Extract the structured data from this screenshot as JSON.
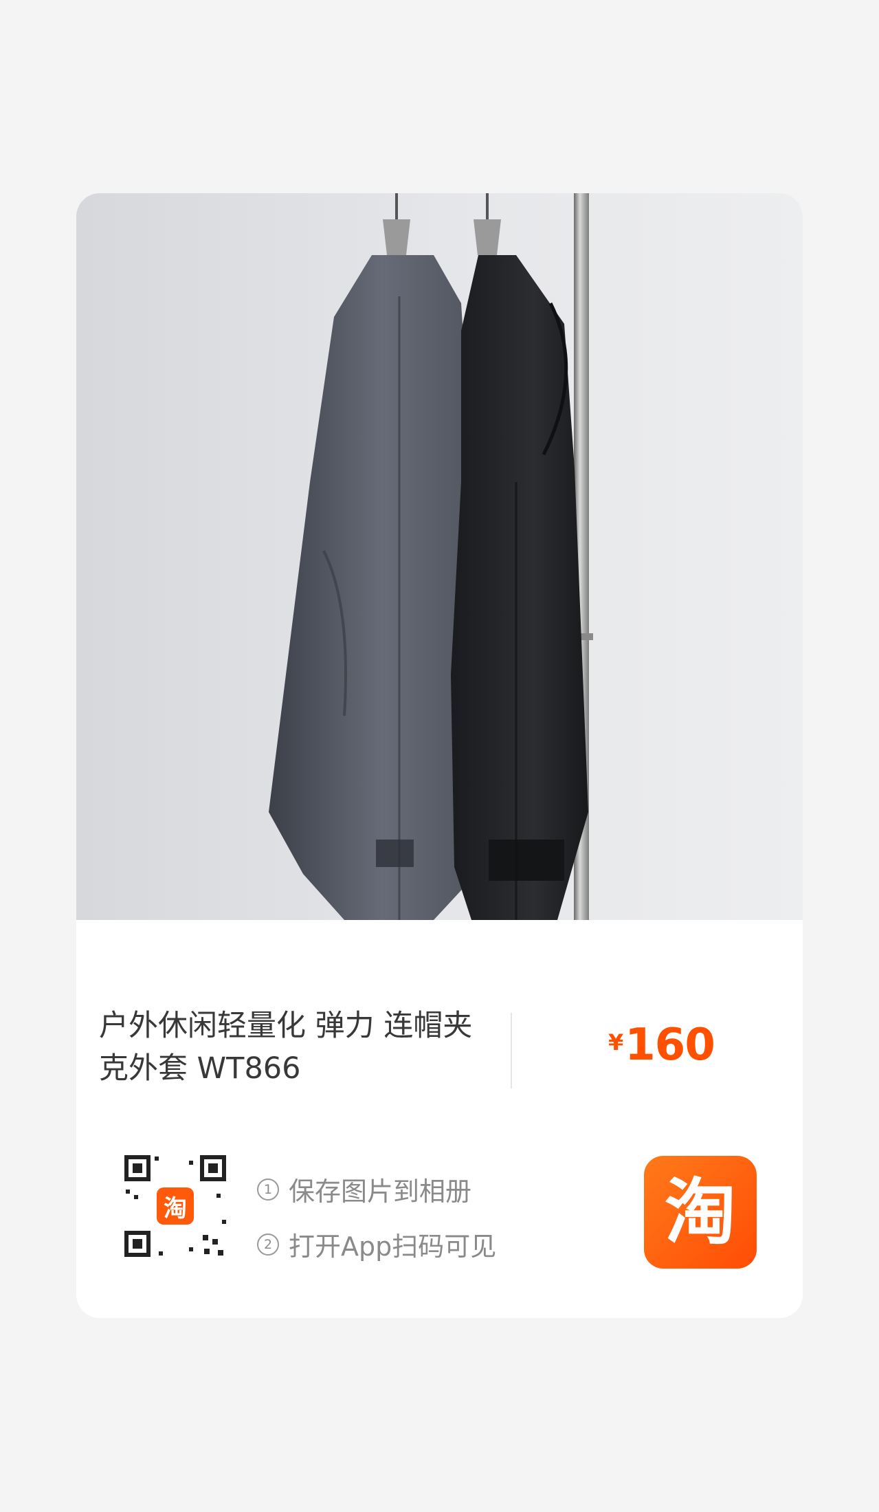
{
  "product": {
    "title": "户外休闲轻量化 弹力 连帽夹克外套 WT866",
    "currency_symbol": "¥",
    "price": "160"
  },
  "share": {
    "steps": [
      {
        "number": "1",
        "text": "保存图片到相册"
      },
      {
        "number": "2",
        "text": "打开App扫码可见"
      }
    ],
    "app_logo_text": "淘",
    "qr_logo_text": "淘"
  },
  "colors": {
    "accent": "#ff5000",
    "background": "#f4f4f4",
    "card": "#ffffff"
  },
  "icons": {
    "brand": "taobao-logo-icon",
    "qr": "qr-code-icon"
  }
}
